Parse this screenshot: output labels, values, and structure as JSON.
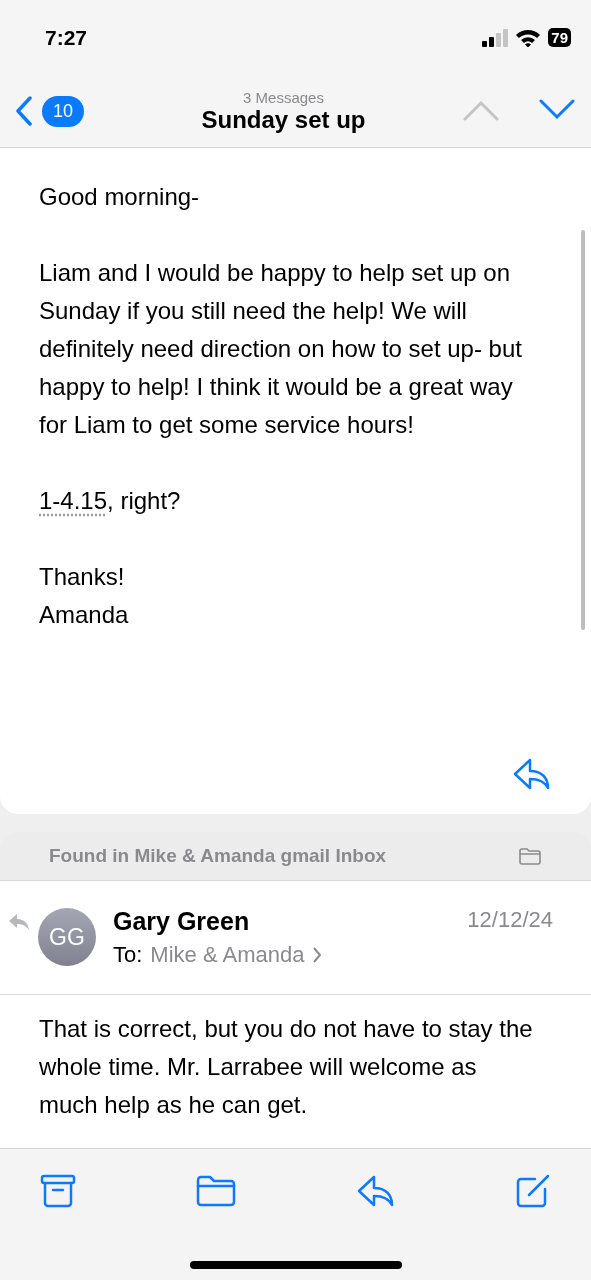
{
  "status_bar": {
    "time": "7:27",
    "battery": "79"
  },
  "nav": {
    "badge": "10",
    "subtitle": "3 Messages",
    "title": "Sunday set up",
    "prev": {
      "disabled": true
    },
    "next": {
      "disabled": false
    }
  },
  "message": {
    "paragraphs": [
      {
        "text": "Good morning-"
      },
      {
        "text": "Liam and I would be happy to help set up on Sunday if you still need the help! We will definitely need direction on how to set up- but happy to help! I think it would be a great way for Liam to get some service hours!"
      },
      {
        "link": "1-4.15",
        "text": ", right?"
      },
      {
        "lines": [
          "Thanks!",
          "Amanda"
        ]
      }
    ]
  },
  "found_in": "Found in Mike & Amanda gmail Inbox",
  "next_message": {
    "replied": true,
    "initials": "GG",
    "sender": "Gary Green",
    "date": "12/12/24",
    "to_label": "To:",
    "to": "Mike & Amanda",
    "body": "That is correct, but you do not have to stay the whole time. Mr. Larrabee will welcome as much help as he can get."
  },
  "toolbar": [
    {
      "kind": "archive"
    },
    {
      "kind": "folder"
    },
    {
      "kind": "reply"
    },
    {
      "kind": "compose"
    }
  ]
}
